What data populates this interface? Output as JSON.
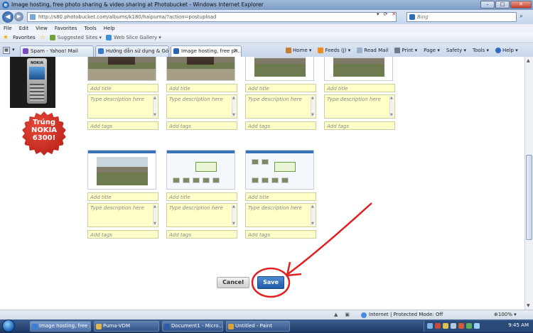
{
  "window": {
    "title": "Image hosting, free photo sharing & video sharing at Photobucket - Windows Internet Explorer"
  },
  "address": {
    "url": "http://s80.photobucket.com/albums/k180/haipuma/?action=postupload",
    "search_placeholder": "Bing"
  },
  "menu": [
    "File",
    "Edit",
    "View",
    "Favorites",
    "Tools",
    "Help"
  ],
  "favorites_bar": {
    "favorites_label": "Favorites",
    "links": [
      "Suggested Sites ▾",
      "Web Slice Gallery ▾"
    ]
  },
  "tabs": [
    {
      "label": "Spam - Yahoo! Mail",
      "active": false
    },
    {
      "label": "Hướng dẫn sử dụng & Gó...",
      "active": false
    },
    {
      "label": "Image hosting, free ph...",
      "active": true
    }
  ],
  "command_bar": [
    "Home ▾",
    "Feeds (J) ▾",
    "Read Mail",
    "Print ▾",
    "Page ▾",
    "Safety ▾",
    "Tools ▾",
    "Help ▾"
  ],
  "ad": {
    "phone_brand": "NOKIA",
    "badge_lines": [
      "Trúng",
      "NOKIA",
      "6300!"
    ]
  },
  "upload_form": {
    "title_placeholder": "Add title",
    "description_placeholder": "Type description here",
    "tags_placeholder": "Add tags"
  },
  "buttons": {
    "cancel": "Cancel",
    "save": "Save"
  },
  "annotation_color": "#e02020",
  "status_bar": {
    "zone": "Internet | Protected Mode: Off",
    "zoom": "⊕100% ▾"
  },
  "taskbar": {
    "items": [
      {
        "label": "Image hosting, free ...",
        "active": true
      },
      {
        "label": "Puma-VDM",
        "active": false
      },
      {
        "label": "Document1 - Micro...",
        "active": false
      },
      {
        "label": "Untitled - Paint",
        "active": false
      }
    ],
    "clock": "9:45 AM"
  }
}
